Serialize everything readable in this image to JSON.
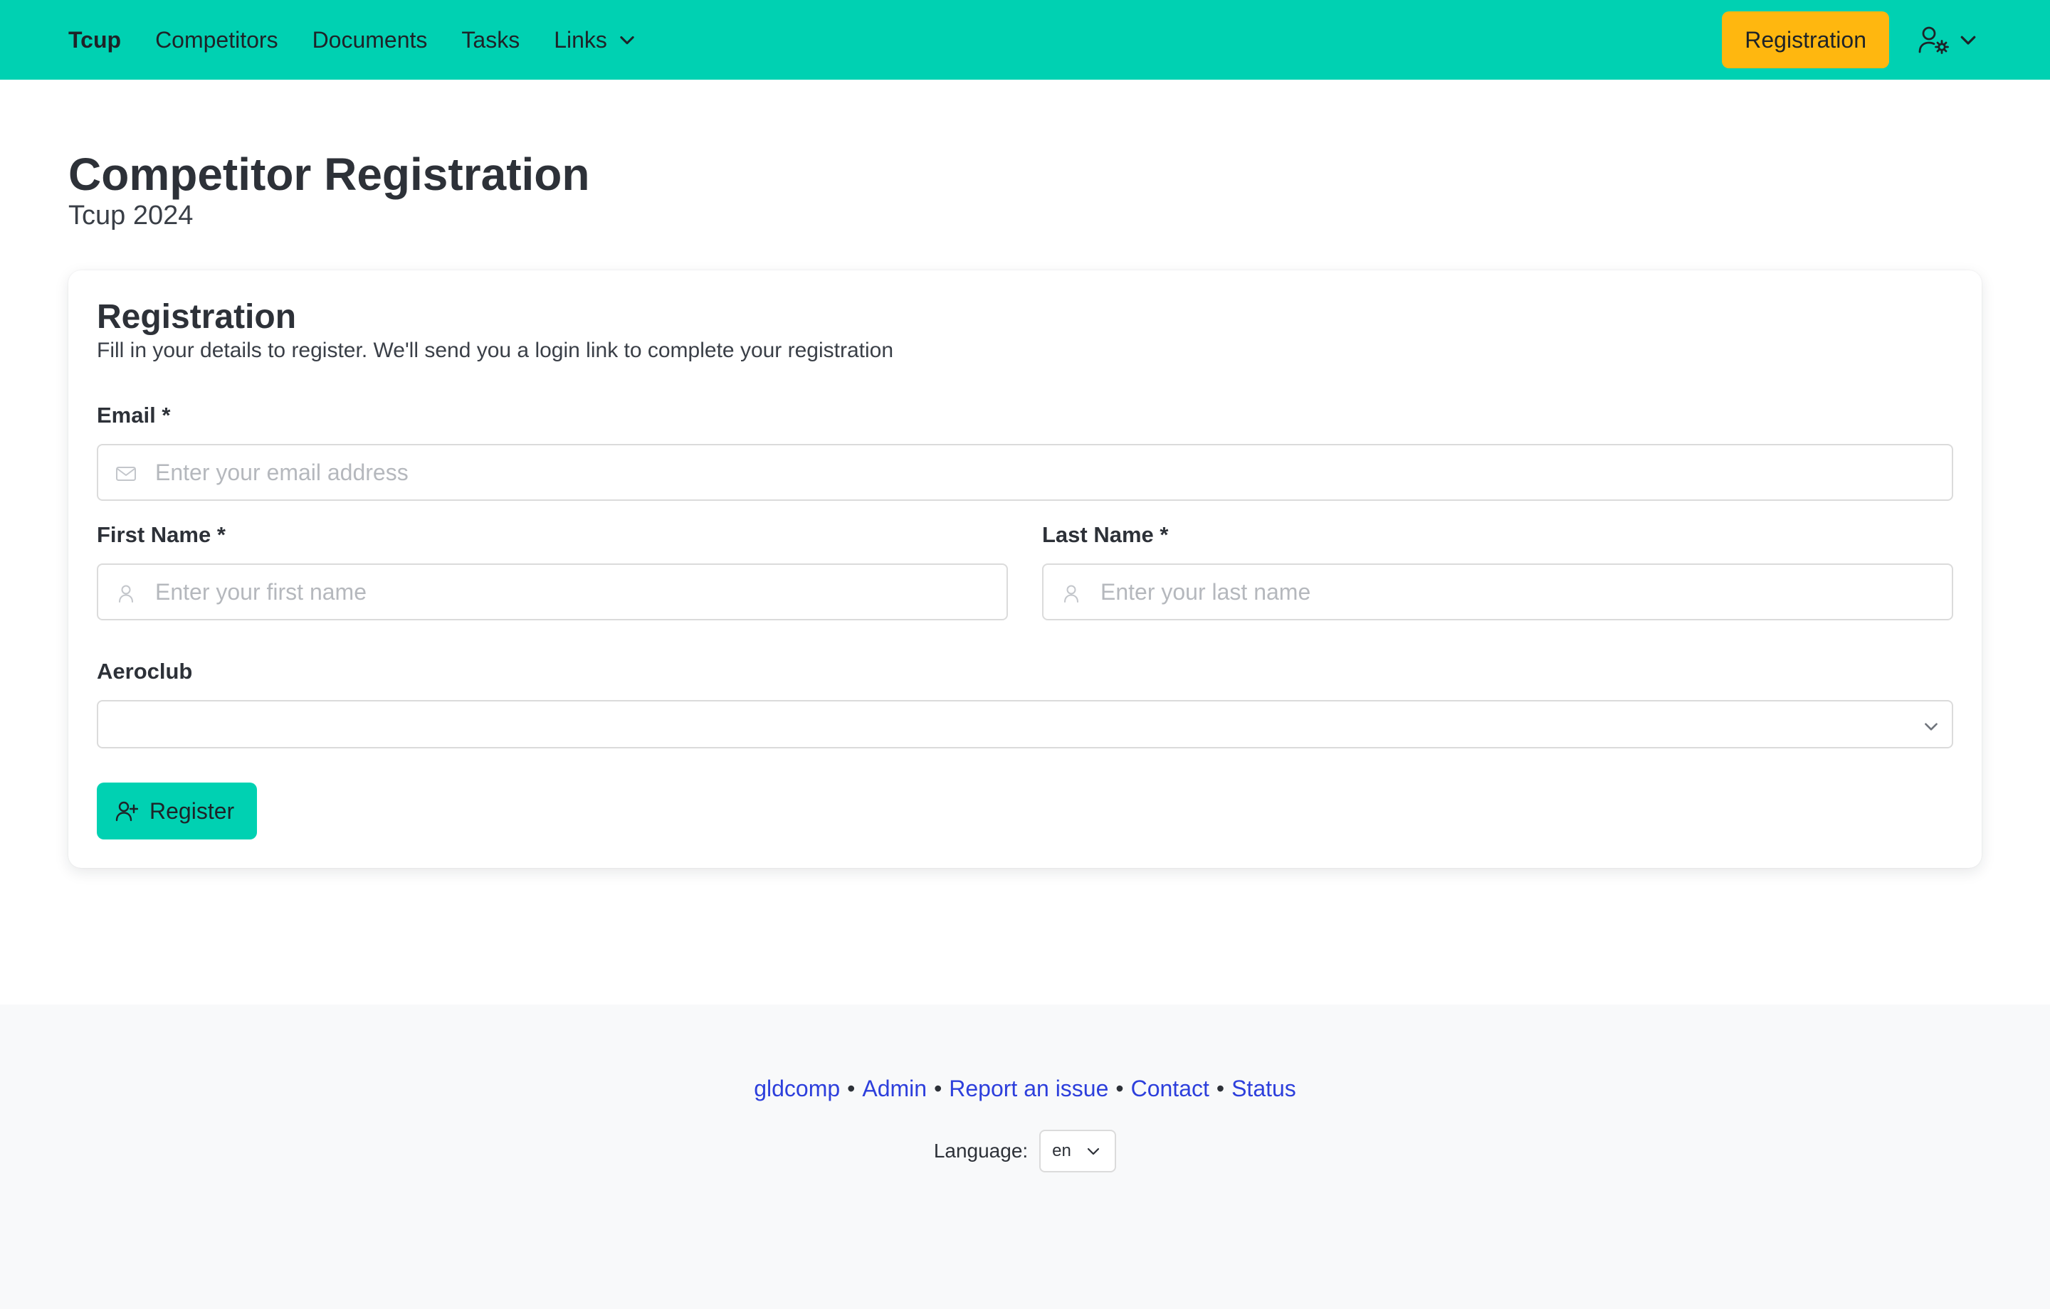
{
  "nav": {
    "brand": "Tcup",
    "items": [
      "Competitors",
      "Documents",
      "Tasks"
    ],
    "links_label": "Links",
    "register_button": "Registration"
  },
  "page": {
    "title": "Competitor Registration",
    "subtitle": "Tcup 2024"
  },
  "card": {
    "title": "Registration",
    "description": "Fill in your details to register. We'll send you a login link to complete your registration",
    "email": {
      "label": "Email *",
      "placeholder": "Enter your email address"
    },
    "first_name": {
      "label": "First Name *",
      "placeholder": "Enter your first name"
    },
    "last_name": {
      "label": "Last Name *",
      "placeholder": "Enter your last name"
    },
    "aeroclub": {
      "label": "Aeroclub",
      "value": ""
    },
    "submit_label": "Register"
  },
  "footer": {
    "links": [
      "gldcomp",
      "Admin",
      "Report an issue",
      "Contact",
      "Status"
    ],
    "separator": "•",
    "language_label": "Language:",
    "language_value": "en"
  },
  "colors": {
    "primary": "#00d1b2",
    "warning": "#ffb70f",
    "link": "#2d3fdc",
    "footer_bg": "#f8f9fa"
  },
  "icons": {
    "email": "envelope-icon",
    "first_name": "user-icon",
    "last_name": "user-icon",
    "register": "user-plus-icon",
    "user_menu": "user-gear-icon"
  }
}
